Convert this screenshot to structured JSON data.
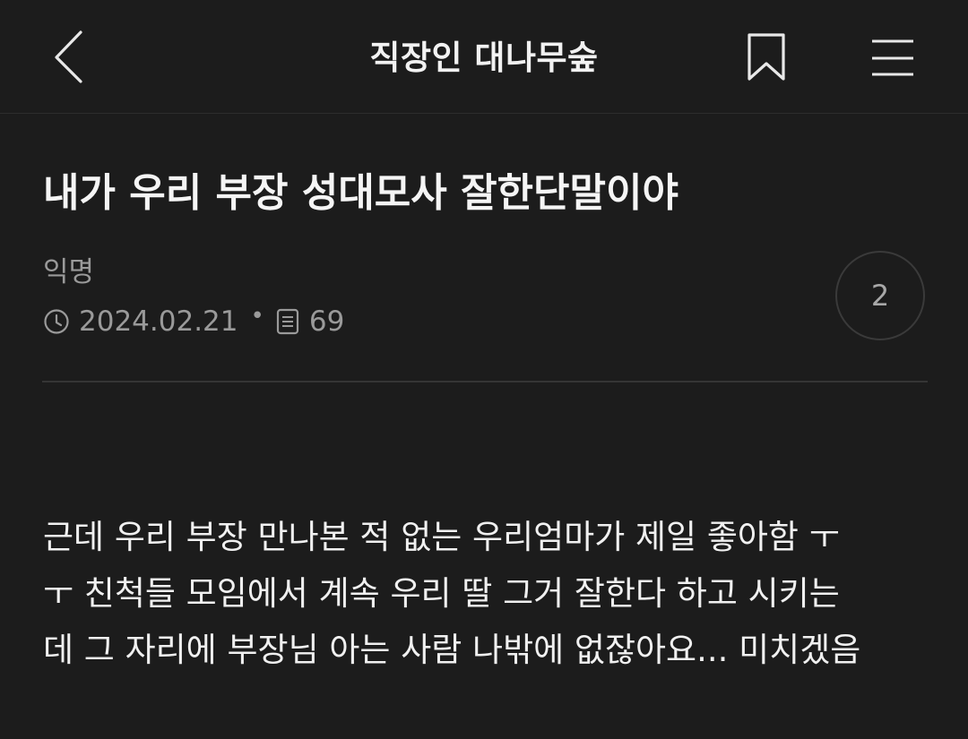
{
  "header": {
    "title": "직장인 대나무숲",
    "back_icon": "chevron-left-icon",
    "bookmark_icon": "bookmark-icon",
    "menu_icon": "hamburger-menu-icon"
  },
  "post": {
    "title": "내가 우리 부장 성대모사 잘한단말이야",
    "author": "익명",
    "date": "2024.02.21",
    "separator": "•",
    "views": "69",
    "comment_count": "2",
    "body_lines": [
      "근데 우리 부장 만나본 적 없는 우리엄마가 제일 좋아함 ㅜ",
      "ㅜ 친척들 모임에서 계속 우리 딸 그거 잘한다 하고 시키는",
      "데 그 자리에 부장님 아는 사람 나밖에 없잖아요... 미치겠음"
    ]
  },
  "colors": {
    "background": "#1c1c1c",
    "text_primary": "#f5f5f5",
    "text_secondary": "#9a9a9a",
    "divider": "#353535"
  }
}
